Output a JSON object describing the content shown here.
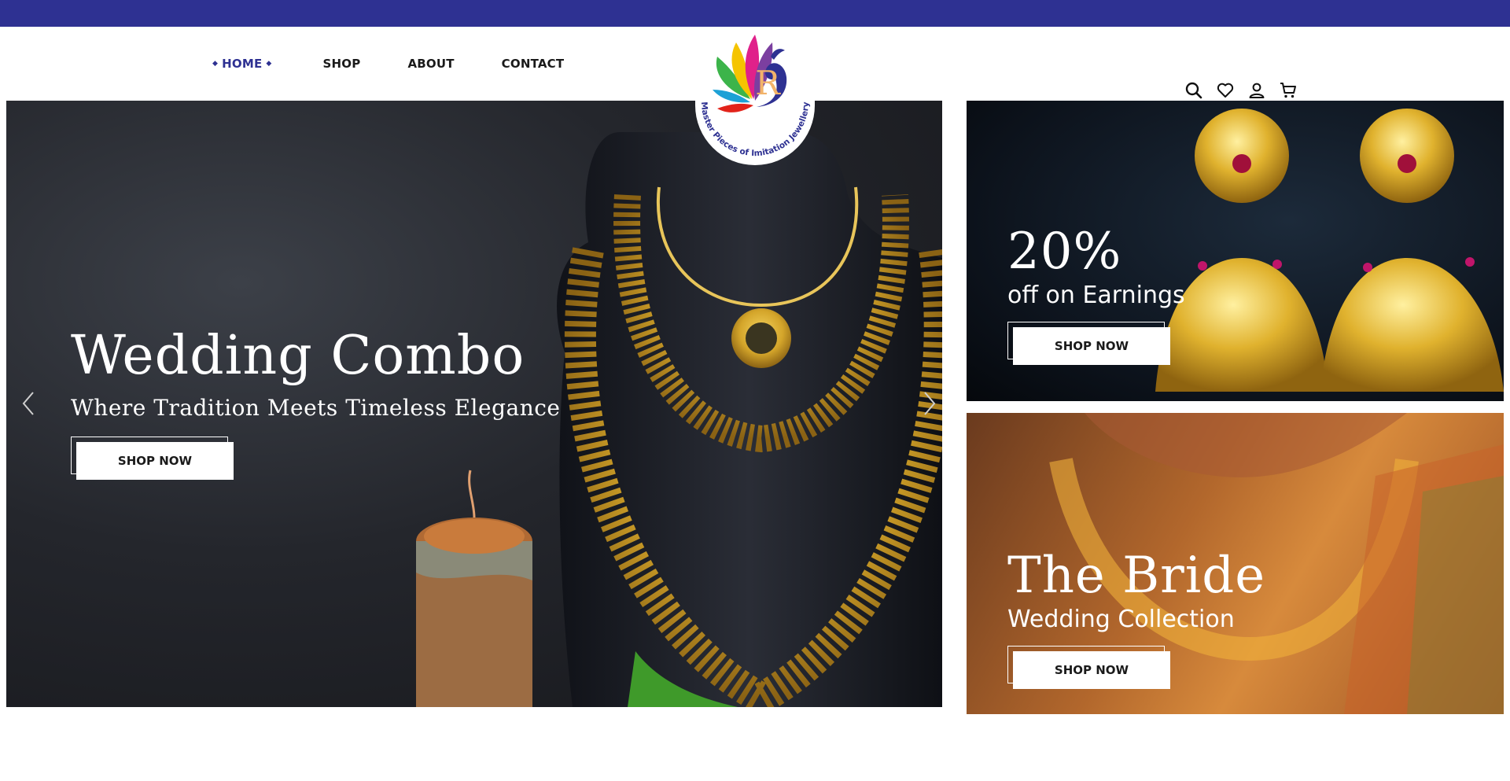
{
  "nav": {
    "items": [
      {
        "label": "HOME",
        "active": true
      },
      {
        "label": "SHOP"
      },
      {
        "label": "ABOUT"
      },
      {
        "label": "CONTACT"
      }
    ]
  },
  "logo": {
    "letter": "R",
    "tagline": "Master Pieces of Imitation Jewellery"
  },
  "header_icons": [
    "search-icon",
    "heart-icon",
    "user-icon",
    "cart-icon"
  ],
  "hero": {
    "title": "Wedding Combo",
    "subtitle": "Where Tradition Meets Timeless Elegance",
    "button": "SHOP NOW"
  },
  "promos": [
    {
      "big": "20%",
      "small": "off on Earnings",
      "button": "SHOP NOW"
    },
    {
      "big": "The Bride",
      "small": "Wedding Collection",
      "button": "SHOP NOW"
    }
  ],
  "colors": {
    "brand": "#2e3192",
    "gold": "#d4a52a"
  }
}
